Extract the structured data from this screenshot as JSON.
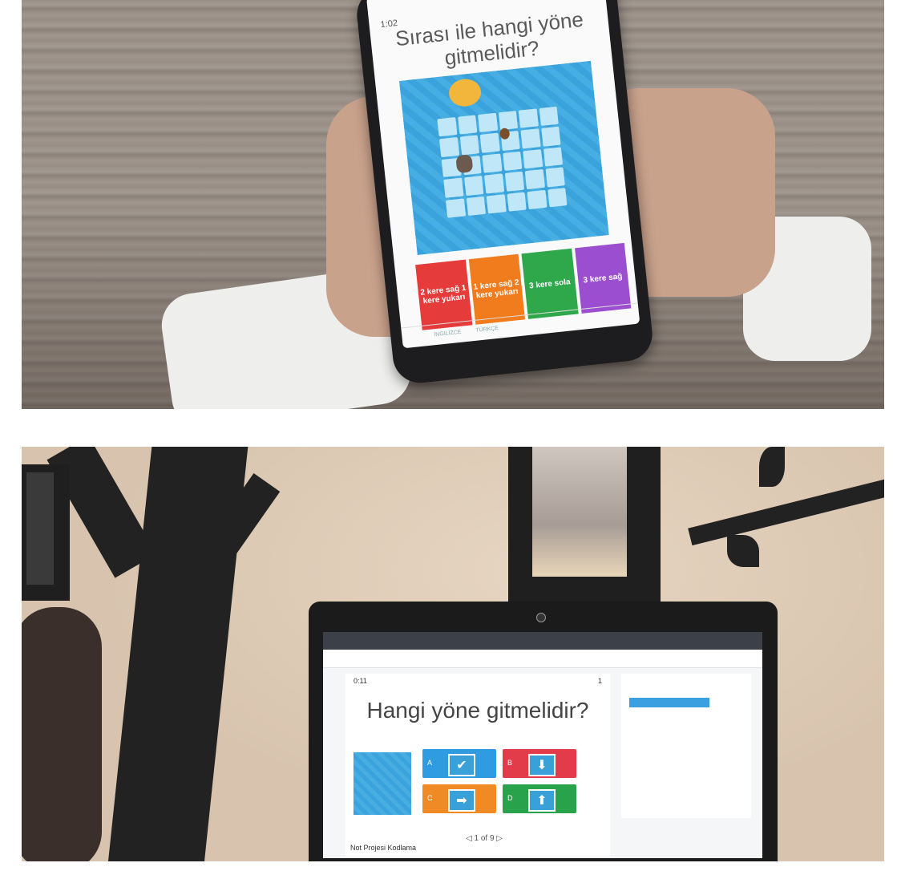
{
  "phone_quiz": {
    "timer": "1:02",
    "question": "Sırası ile hangi yöne gitmelidir?",
    "answers": [
      {
        "label": "2 kere sağ 1 kere yukarı",
        "color": "#e53b3b"
      },
      {
        "label": "1 kere sağ 2 kere yukarı",
        "color": "#f07c1e"
      },
      {
        "label": "3 kere sola",
        "color": "#2ea84a"
      },
      {
        "label": "3 kere sağ",
        "color": "#9b4fd0"
      }
    ],
    "footer": [
      "İNGİLİZCE",
      "TÜRKÇE"
    ]
  },
  "laptop_quiz": {
    "timer": "0:11",
    "question": "Hangi yöne gitmelidir?",
    "answers": [
      {
        "letter": "A",
        "color": "#2f9be0",
        "icon": "check-icon"
      },
      {
        "letter": "B",
        "color": "#e23c4a",
        "icon": "arrow-down-icon"
      },
      {
        "letter": "C",
        "color": "#f08a24",
        "icon": "arrow-right-icon"
      },
      {
        "letter": "D",
        "color": "#29a24c",
        "icon": "arrow-up-icon"
      }
    ],
    "pager": "1 of 9",
    "project_title": "Not Projesi Kodlama",
    "score": "1"
  }
}
